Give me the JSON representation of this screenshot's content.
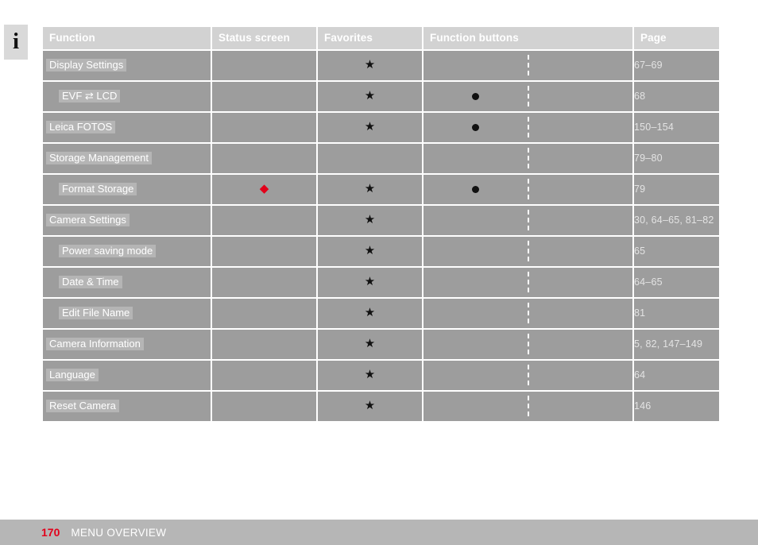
{
  "info_icon": {
    "glyph": "i",
    "name": "info-icon"
  },
  "table": {
    "columns": [
      {
        "key": "function",
        "label": "Function"
      },
      {
        "key": "status_screen",
        "label": "Status screen"
      },
      {
        "key": "favorites",
        "label": "Favorites"
      },
      {
        "key": "function_buttons",
        "label": "Function buttons"
      },
      {
        "key": "page",
        "label": "Page"
      }
    ],
    "rows": [
      {
        "function": "Display Settings",
        "indent": 1,
        "status_screen": "",
        "favorites": "★",
        "fbtn_left": "",
        "fbtn_right": "",
        "page": "67–69"
      },
      {
        "function": "EVF ⇄ LCD",
        "indent": 2,
        "status_screen": "",
        "favorites": "★",
        "fbtn_left": "●",
        "fbtn_right": "",
        "page": "68"
      },
      {
        "function": "Leica FOTOS",
        "indent": 1,
        "status_screen": "",
        "favorites": "★",
        "fbtn_left": "●",
        "fbtn_right": "",
        "page": "150–154"
      },
      {
        "function": "Storage Management",
        "indent": 1,
        "status_screen": "",
        "favorites": "",
        "fbtn_left": "",
        "fbtn_right": "",
        "page": "79–80"
      },
      {
        "function": "Format Storage",
        "indent": 2,
        "status_screen": "◆",
        "favorites": "★",
        "fbtn_left": "●",
        "fbtn_right": "",
        "page": "79"
      },
      {
        "function": "Camera Settings",
        "indent": 1,
        "status_screen": "",
        "favorites": "★",
        "fbtn_left": "",
        "fbtn_right": "",
        "page": "30, 64–65, 81–82"
      },
      {
        "function": "Power saving mode",
        "indent": 2,
        "status_screen": "",
        "favorites": "★",
        "fbtn_left": "",
        "fbtn_right": "",
        "page": "65"
      },
      {
        "function": "Date & Time",
        "indent": 2,
        "status_screen": "",
        "favorites": "★",
        "fbtn_left": "",
        "fbtn_right": "",
        "page": "64–65"
      },
      {
        "function": "Edit File Name",
        "indent": 2,
        "status_screen": "",
        "favorites": "★",
        "fbtn_left": "",
        "fbtn_right": "",
        "page": "81"
      },
      {
        "function": "Camera Information",
        "indent": 1,
        "status_screen": "",
        "favorites": "★",
        "fbtn_left": "",
        "fbtn_right": "",
        "page": "5, 82, 147–149"
      },
      {
        "function": "Language",
        "indent": 1,
        "status_screen": "",
        "favorites": "★",
        "fbtn_left": "",
        "fbtn_right": "",
        "page": "64"
      },
      {
        "function": "Reset Camera",
        "indent": 1,
        "status_screen": "",
        "favorites": "★",
        "fbtn_left": "",
        "fbtn_right": "",
        "page": "146"
      }
    ]
  },
  "footer": {
    "page_number": "170",
    "section_title": "MENU OVERVIEW"
  },
  "colors": {
    "header_bg": "#d2d2d2",
    "row_bg": "#9d9d9d",
    "label_bg": "#b5b5b5",
    "footer_bg": "#b6b6b6",
    "accent_red": "#e2001a",
    "text_white": "#ffffff",
    "marker_black": "#111111"
  }
}
